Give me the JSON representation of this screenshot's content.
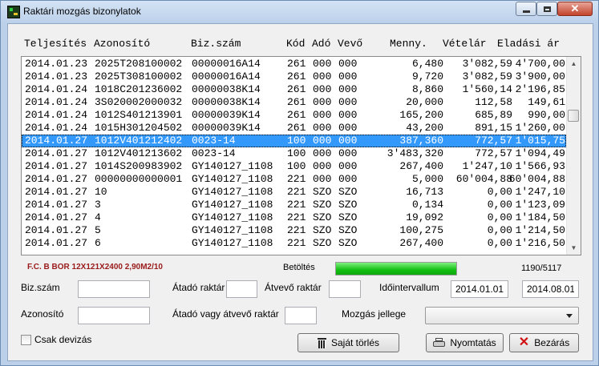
{
  "window": {
    "title": "Raktári mozgás bizonylatok"
  },
  "table": {
    "headers": [
      "Teljesítés",
      "Azonosító",
      "Biz.szám",
      "Kód",
      "Adó",
      "Vevő",
      "Menny.",
      "Vételár",
      "Eladási ár"
    ],
    "rows": [
      [
        "2014.01.23",
        "2025T208100002",
        "00000016A14",
        "261",
        "000",
        "000",
        "6,480",
        "3'082,59",
        "4'700,00"
      ],
      [
        "2014.01.23",
        "2025T308100002",
        "00000016A14",
        "261",
        "000",
        "000",
        "9,720",
        "3'082,59",
        "3'900,00"
      ],
      [
        "2014.01.24",
        "1018C201236002",
        "00000038K14",
        "261",
        "000",
        "000",
        "8,860",
        "1'560,14",
        "2'196,85"
      ],
      [
        "2014.01.24",
        "3S020002000032",
        "00000038K14",
        "261",
        "000",
        "000",
        "20,000",
        "112,58",
        "149,61"
      ],
      [
        "2014.01.24",
        "1012S401213901",
        "00000039K14",
        "261",
        "000",
        "000",
        "165,200",
        "685,89",
        "990,00"
      ],
      [
        "2014.01.24",
        "1015H301204502",
        "00000039K14",
        "261",
        "000",
        "000",
        "43,200",
        "891,15",
        "1'260,00"
      ],
      [
        "2014.01.27",
        "1012V401212402",
        "0023-14",
        "100",
        "000",
        "000",
        "387,360",
        "772,57",
        "1'015,75"
      ],
      [
        "2014.01.27",
        "1012V401213602",
        "0023-14",
        "100",
        "000",
        "000",
        "3'483,320",
        "772,57",
        "1'094,49"
      ],
      [
        "2014.01.27",
        "1014S200983902",
        "GY140127_1108",
        "100",
        "000",
        "000",
        "267,400",
        "1'247,10",
        "1'566,93"
      ],
      [
        "2014.01.27",
        "00000000000001",
        "GY140127_1108",
        "221",
        "000",
        "000",
        "5,000",
        "60'004,88",
        "60'004,88"
      ],
      [
        "2014.01.27",
        "10",
        "GY140127_1108",
        "221",
        "SZO",
        "SZO",
        "16,713",
        "0,00",
        "1'247,10"
      ],
      [
        "2014.01.27",
        "3",
        "GY140127_1108",
        "221",
        "SZO",
        "SZO",
        "0,134",
        "0,00",
        "1'123,09"
      ],
      [
        "2014.01.27",
        "4",
        "GY140127_1108",
        "221",
        "SZO",
        "SZO",
        "19,092",
        "0,00",
        "1'184,50"
      ],
      [
        "2014.01.27",
        "5",
        "GY140127_1108",
        "221",
        "SZO",
        "SZO",
        "100,275",
        "0,00",
        "1'214,50"
      ],
      [
        "2014.01.27",
        "6",
        "GY140127_1108",
        "221",
        "SZO",
        "SZO",
        "267,400",
        "0,00",
        "1'216,50"
      ]
    ],
    "selected_index": 6
  },
  "product_info": "F.C. B BOR 12X121X2400 2,90M2/10",
  "loading": {
    "label": "Betöltés",
    "progress": 1.0,
    "count": "1190/5117"
  },
  "form": {
    "biz_szam_label": "Biz.szám",
    "atado_raktar_label": "Átadó raktár",
    "atvevo_raktar_label": "Átvevő raktár",
    "idointervallum_label": "Időintervallum",
    "date_from": "2014.01.01",
    "date_to": "2014.08.01",
    "azonosito_label": "Azonosító",
    "atado_vagy_atvevo_label": "Átadó vagy átvevő raktár",
    "mozgas_jellege_label": "Mozgás jellege",
    "csak_devizas_label": "Csak devizás"
  },
  "buttons": {
    "sajat_torles": "Saját törlés",
    "nyomtatas": "Nyomtatás",
    "bezaras": "Bezárás"
  },
  "colors": {
    "selection": "#3399ff",
    "product_text": "#9a1a1a",
    "progress": "#12c012",
    "close_x": "#d01010"
  }
}
